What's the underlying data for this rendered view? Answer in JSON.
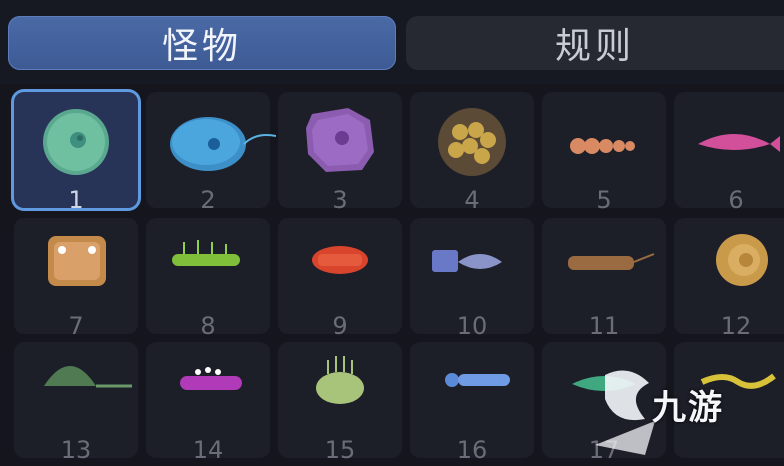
{
  "tabs": {
    "monsters": "怪物",
    "rules": "规则"
  },
  "selected_index": 0,
  "monsters": [
    {
      "number": "1",
      "icon": "green-cell-icon"
    },
    {
      "number": "2",
      "icon": "flagellate-icon"
    },
    {
      "number": "3",
      "icon": "purple-cell-icon"
    },
    {
      "number": "4",
      "icon": "egg-cluster-icon"
    },
    {
      "number": "5",
      "icon": "segmented-worm-icon"
    },
    {
      "number": "6",
      "icon": "pink-fish-icon"
    },
    {
      "number": "7",
      "icon": "trilobite-icon"
    },
    {
      "number": "8",
      "icon": "green-caterpillar-icon"
    },
    {
      "number": "9",
      "icon": "red-crustacean-icon"
    },
    {
      "number": "10",
      "icon": "armored-fish-icon"
    },
    {
      "number": "11",
      "icon": "shrimp-icon"
    },
    {
      "number": "12",
      "icon": "ammonite-icon"
    },
    {
      "number": "13",
      "icon": "helmet-creature-icon"
    },
    {
      "number": "14",
      "icon": "magenta-worm-icon"
    },
    {
      "number": "15",
      "icon": "spiky-blob-icon"
    },
    {
      "number": "16",
      "icon": "blue-centipede-icon"
    },
    {
      "number": "17",
      "icon": "green-fish-icon"
    },
    {
      "number": "",
      "icon": "yellow-eel-icon"
    }
  ],
  "watermark": {
    "text": "九游"
  }
}
